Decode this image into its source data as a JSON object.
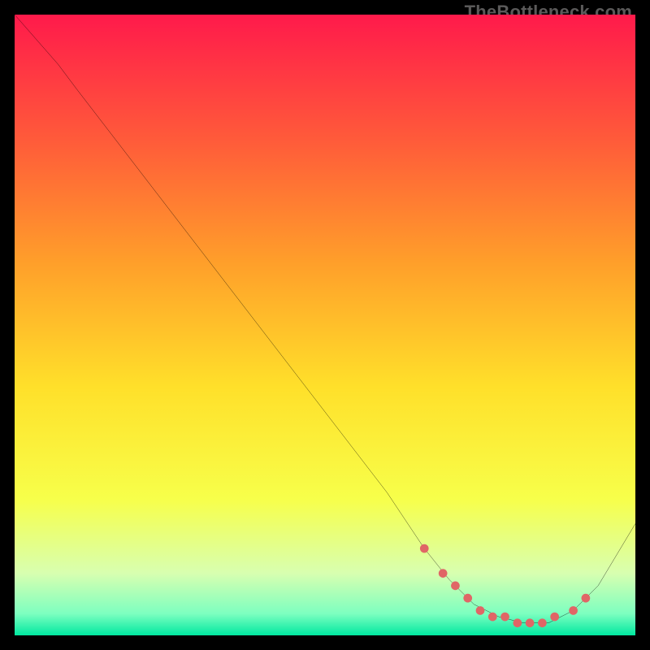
{
  "watermark": "TheBottleneck.com",
  "chart_data": {
    "type": "line",
    "title": "",
    "xlabel": "",
    "ylabel": "",
    "xlim": [
      0,
      100
    ],
    "ylim": [
      0,
      100
    ],
    "grid": false,
    "legend": false,
    "background_gradient": {
      "stops": [
        {
          "offset": 0.0,
          "color": "#ff1a4b"
        },
        {
          "offset": 0.2,
          "color": "#ff5a3a"
        },
        {
          "offset": 0.4,
          "color": "#ff9f2a"
        },
        {
          "offset": 0.6,
          "color": "#ffe02a"
        },
        {
          "offset": 0.78,
          "color": "#f7ff4a"
        },
        {
          "offset": 0.9,
          "color": "#d8ffb0"
        },
        {
          "offset": 0.965,
          "color": "#7dffc0"
        },
        {
          "offset": 1.0,
          "color": "#00e8a0"
        }
      ]
    },
    "series": [
      {
        "name": "bottleneck-curve",
        "type": "line",
        "color": "#000000",
        "width": 2.5,
        "x": [
          0,
          7,
          10,
          20,
          30,
          40,
          50,
          60,
          66,
          70,
          74,
          78,
          82,
          86,
          90,
          94,
          100
        ],
        "y": [
          100,
          92,
          88,
          75,
          62,
          49,
          36,
          23,
          14,
          9,
          5,
          3,
          2,
          2,
          4,
          8,
          18
        ]
      },
      {
        "name": "optimal-range-markers",
        "type": "scatter",
        "color": "#e06666",
        "radius": 5,
        "x": [
          66,
          69,
          71,
          73,
          75,
          77,
          79,
          81,
          83,
          85,
          87,
          90,
          92
        ],
        "y": [
          14,
          10,
          8,
          6,
          4,
          3,
          3,
          2,
          2,
          2,
          3,
          4,
          6
        ]
      }
    ]
  }
}
